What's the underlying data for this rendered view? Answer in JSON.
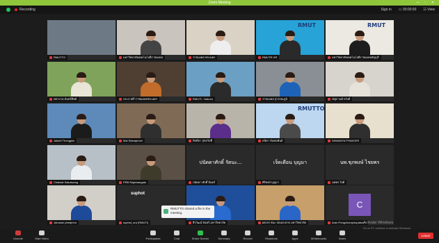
{
  "window": {
    "title": "Zoom Meeting",
    "controls": "— ▫ ✕",
    "titlebar_color": "#8fc63c"
  },
  "status": {
    "recording_label": "Recording",
    "right_items": [
      "Sign in",
      "▭ 00:00:00",
      "☷ View"
    ]
  },
  "tiles": [
    {
      "name": "RMUTTO",
      "scene": "#6d7a86",
      "person": false
    },
    {
      "name": "มหาวิทยาลัยเทคโนโลยีราชมงคล",
      "scene": "#c9c4bd",
      "person": true,
      "body": "#444444"
    },
    {
      "name": "ราชมงคล พระนคร",
      "scene": "#d9d2c5",
      "person": true,
      "body": "#eeeeee"
    },
    {
      "name": "RMUTR HR",
      "scene": "#27a3d7",
      "person": true,
      "body": "#2a2a2a",
      "brand": "RMUT"
    },
    {
      "name": "มหาวิทยาลัยเทคโนโลยีราชมงคลธัญบุรี",
      "scene": "#ece9e3",
      "person": true,
      "body": "#1d1d1d",
      "brand": "RMUT"
    },
    {
      "name": "พยาบาล-จันทร์ทิพย์",
      "scene": "#7fa35a",
      "person": true,
      "body": "#e8e4d6"
    },
    {
      "name": "ประภาศรี ราชมงคลพระนคร",
      "scene": "#4f3f33",
      "person": true,
      "body": "#c16c2a"
    },
    {
      "name": "RMUTI - Nakorn",
      "scene": "#6b9fc4",
      "person": true,
      "body": "#2b2b2b"
    },
    {
      "name": "ราชมงคล สุวรรณภูมิ",
      "scene": "#8a8f96",
      "person": true,
      "body": "#1e63b8"
    },
    {
      "name": "ณัฐกานต์ หวังดี",
      "scene": "#d7d3cd",
      "person": true,
      "body": "#e6e2da"
    },
    {
      "name": "Jakkrit Thongpim",
      "scene": "#5d8ab8",
      "person": true,
      "body": "#1b1b1b"
    },
    {
      "name": "Mai Sitaraphorn",
      "scene": "#7f6a55",
      "person": true,
      "body": "#2f2f2f"
    },
    {
      "name": "กิตติยา สุขสวัสดิ์",
      "scene": "#b9b4aa",
      "person": true,
      "body": "#5a2e8a"
    },
    {
      "name": "ธนิดา จันทนพันธ์",
      "scene": "#bcd7ef",
      "person": true,
      "body": "#4a4a4a",
      "brand": "RMUTTO"
    },
    {
      "name": "SAWANYA PHAKDEE",
      "scene": "#e7e0cf",
      "person": true,
      "body": "#2f2f2f"
    },
    {
      "name": "Chaiwat Sakulwong",
      "scene": "#b7c0c6",
      "person": true,
      "body": "#e9edf0"
    },
    {
      "name": "PRB Rajamangala",
      "scene": "#5a5046",
      "person": true,
      "body": "#3e3b2a"
    },
    {
      "name": "ปนัดดา ศักดิ์ อินทร์",
      "thai": "ปนัดดาศักดิ์ รัตนะ..."
    },
    {
      "name": "ศิริพงษ์ บุญมา",
      "thai": "เจ็ดเดือน บุญมา"
    },
    {
      "name": "นพพร ใจดี",
      "thai": "นพ.ชุภพงษ์ ไชยพร"
    },
    {
      "name": "Jaruwan phetphon",
      "scene": "#d2cfc8",
      "person": true,
      "body": "#1e4a9a"
    },
    {
      "name": "suphot_sra (RMUTI)",
      "bigtext": "suphot"
    },
    {
      "name": "ธีรวัฒน์ จันทร์ มหาวิทยาลัย",
      "scene": "#1f4f9b",
      "person": true,
      "body": "#2a6bd0"
    },
    {
      "name": "ผศ.ดร.ชนะ สอนสะอาด มหาวิทยาลัย",
      "scene": "#c79f6a",
      "person": true,
      "body": "#2a66c7"
    },
    {
      "name": "Aran Pongchomphupatsorn",
      "avatar": "C"
    }
  ],
  "toast": {
    "text": "RMUTTO shared a file in the meeting."
  },
  "toolbar": {
    "items": [
      {
        "label": "Unmute",
        "icon": "microphone-icon",
        "cls": "mute"
      },
      {
        "label": "Start Video",
        "icon": "video-camera-icon",
        "cls": ""
      },
      {
        "label": "Participants",
        "icon": "participants-icon",
        "cls": ""
      },
      {
        "label": "Chat",
        "icon": "chat-icon",
        "cls": ""
      },
      {
        "label": "Share Screen",
        "icon": "share-screen-icon",
        "cls": "share"
      },
      {
        "label": "Summary",
        "icon": "summary-icon",
        "cls": ""
      },
      {
        "label": "Record",
        "icon": "record-icon",
        "cls": ""
      },
      {
        "label": "Reactions",
        "icon": "reactions-icon",
        "cls": ""
      },
      {
        "label": "Apps",
        "icon": "apps-icon",
        "cls": ""
      },
      {
        "label": "Whiteboards",
        "icon": "whiteboard-icon",
        "cls": ""
      },
      {
        "label": "Notes",
        "icon": "notes-icon",
        "cls": ""
      }
    ],
    "leave_label": "Leave"
  },
  "activation": {
    "title": "Activate Windows",
    "subtitle": "Go to PC settings to activate Windows."
  }
}
